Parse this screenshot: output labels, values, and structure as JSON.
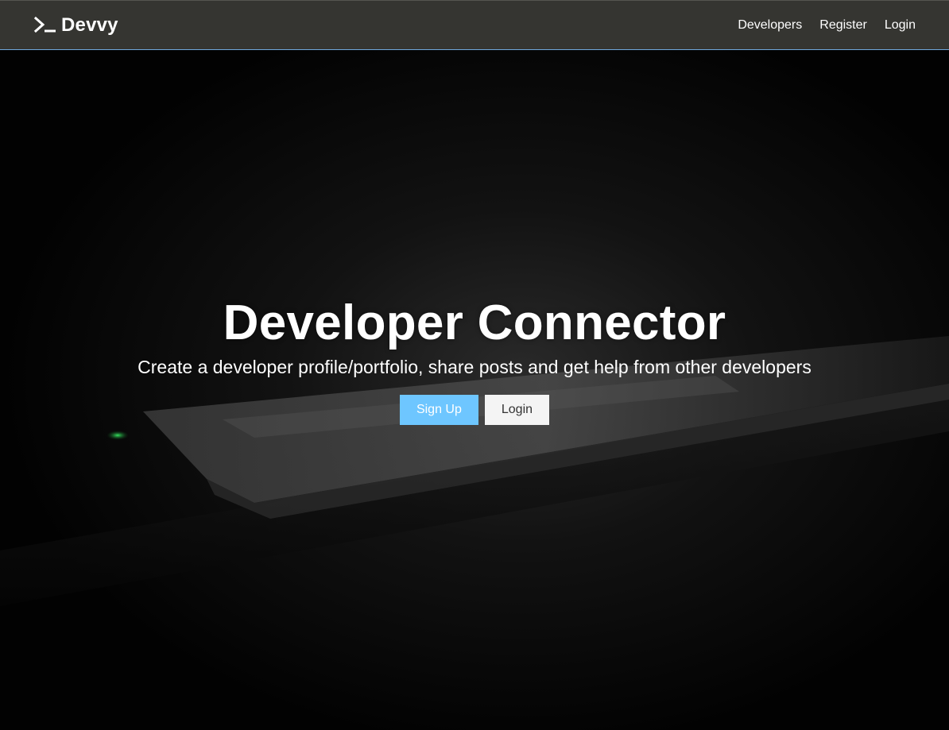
{
  "navbar": {
    "brand": "Devvy",
    "links": [
      "Developers",
      "Register",
      "Login"
    ]
  },
  "hero": {
    "title": "Developer Connector",
    "lead": "Create a developer profile/portfolio, share posts and get help from other developers",
    "buttons": {
      "signup": "Sign Up",
      "login": "Login"
    }
  },
  "colors": {
    "navbar_bg": "#353531",
    "navbar_border": "#6fa8dc",
    "primary": "#6ec6ff",
    "light": "#f4f4f4"
  },
  "icons": [
    "terminal-icon"
  ]
}
